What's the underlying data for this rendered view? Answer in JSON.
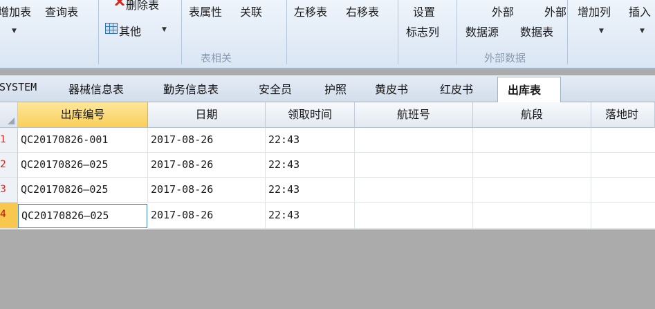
{
  "ribbon": {
    "add_table": "增加表",
    "query_table": "查询表",
    "delete_table": "删除表",
    "other": "其他",
    "table_properties": "表属性",
    "relate": "关联",
    "move_left": "左移表",
    "move_right": "右移表",
    "set_flag_col_line1": "设置",
    "set_flag_col_line2": "标志列",
    "ext_source_line1": "外部",
    "ext_source_line2": "数据源",
    "ext_table_line1": "外部",
    "ext_table_line2": "数据表",
    "add_column": "增加列",
    "insert": "插入",
    "group_table": "表相关",
    "group_external": "外部数据"
  },
  "tabs": [
    "SYSTEM",
    "器械信息表",
    "勤务信息表",
    "安全员",
    "护照",
    "黄皮书",
    "红皮书",
    "出库表"
  ],
  "active_tab": "出库表",
  "grid": {
    "columns": [
      "出库编号",
      "日期",
      "领取时间",
      "航班号",
      "航段",
      "落地时"
    ],
    "row_numbers": [
      "1",
      "2",
      "3",
      "4"
    ],
    "rows": [
      [
        "QC20170826-001",
        "2017-08-26",
        "22:43",
        "",
        "",
        ""
      ],
      [
        "QC20170826—025",
        "2017-08-26",
        "22:43",
        "",
        "",
        ""
      ],
      [
        "QC20170826—025",
        "2017-08-26",
        "22:43",
        "",
        "",
        ""
      ],
      [
        "QC20170826—025",
        "2017-08-26",
        "22:43",
        "",
        "",
        ""
      ]
    ]
  },
  "colors": {
    "selected_header": "#f9cf5a",
    "row_number_text": "#e0201a",
    "focus_border": "#3a7bd5"
  }
}
